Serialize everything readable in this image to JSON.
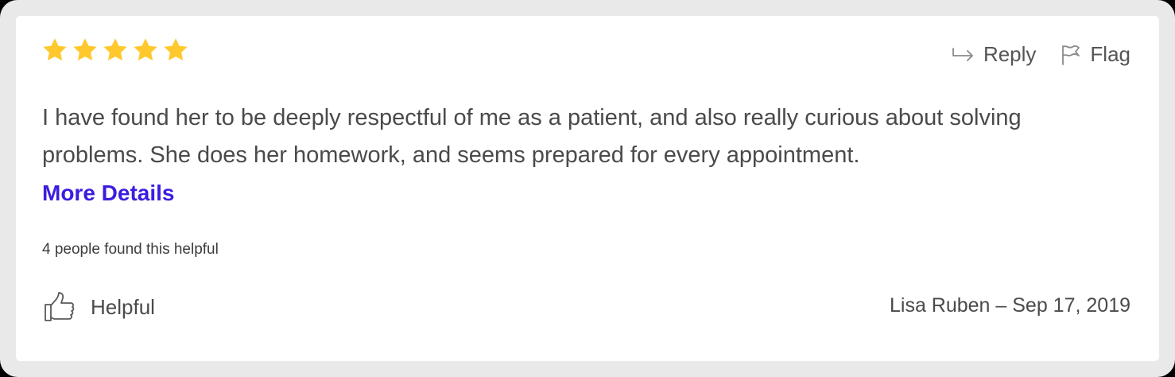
{
  "review": {
    "rating": 5,
    "rating_max": 5,
    "star_color": "#ffc82c",
    "text": "I have found her to be deeply respectful of me as a patient, and also really curious about solving problems. She does her homework, and seems prepared for every appointment.",
    "more_label": "More Details",
    "link_color": "#3a1ee0",
    "helpful_count_text": "4 people found this helpful",
    "helpful_label": "Helpful",
    "author_line": "Lisa Ruben – Sep 17, 2019"
  },
  "actions": {
    "reply_label": "Reply",
    "reply_icon": "reply-arrow-icon",
    "flag_label": "Flag",
    "flag_icon": "flag-icon"
  },
  "icons": {
    "star": "star-icon",
    "helpful": "thumbs-up-icon"
  }
}
